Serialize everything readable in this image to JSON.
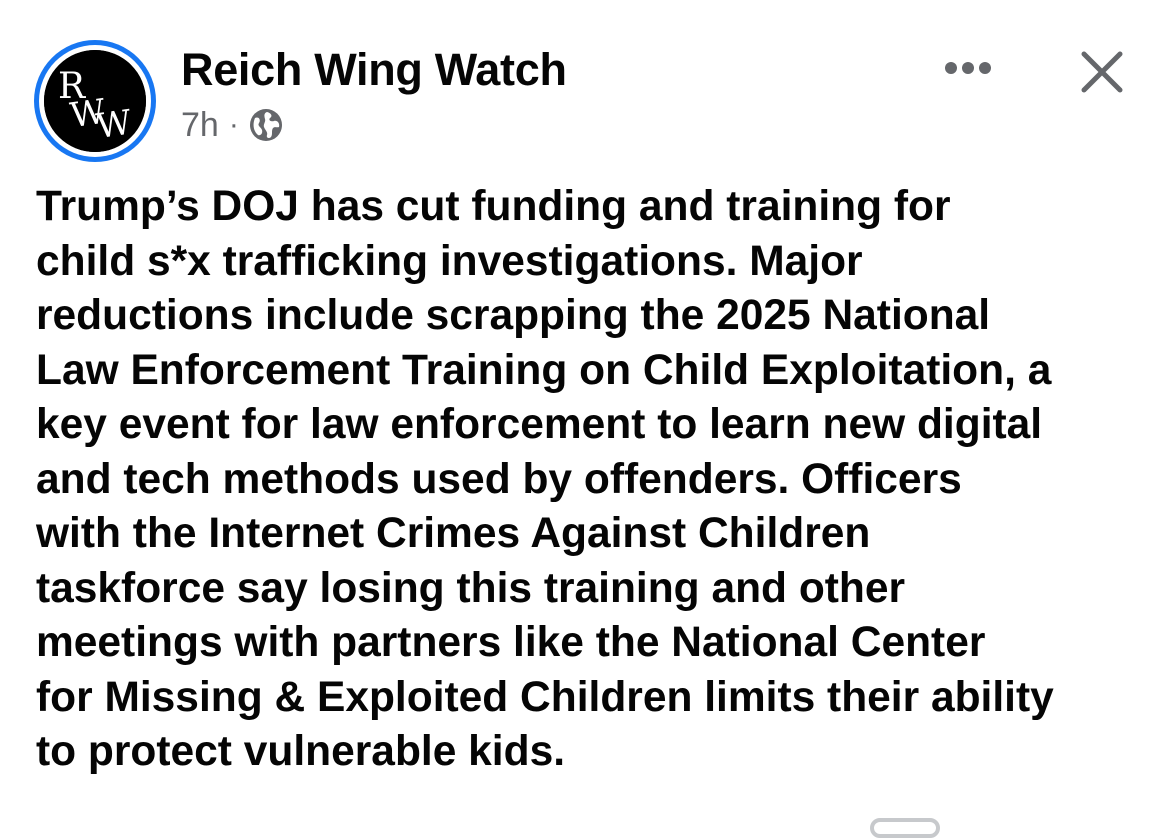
{
  "post": {
    "author": {
      "name": "Reich Wing Watch",
      "avatar_initials": "RWW",
      "avatar_ring_color": "#1877f2"
    },
    "timestamp": "7h",
    "separator": "·",
    "audience_icon": "globe-icon",
    "actions": {
      "more_icon": "more-horizontal-icon",
      "close_icon": "close-icon"
    },
    "text_lines": [
      "Trump’s DOJ has cut funding and training for",
      "child s*x trafficking investigations. Major",
      "reductions include scrapping the 2025 National",
      "Law Enforcement Training on Child Exploitation, a",
      "key event for law enforcement to learn new digital",
      "and tech methods used by offenders. Officers",
      "with the Internet Crimes Against Children",
      "taskforce say losing this training and other",
      "meetings with partners like the National Center",
      "for Missing & Exploited Children limits their ability",
      "to protect vulnerable kids."
    ]
  },
  "colors": {
    "text_primary": "#050505",
    "text_secondary": "#65676b",
    "accent": "#1877f2",
    "background": "#ffffff"
  }
}
